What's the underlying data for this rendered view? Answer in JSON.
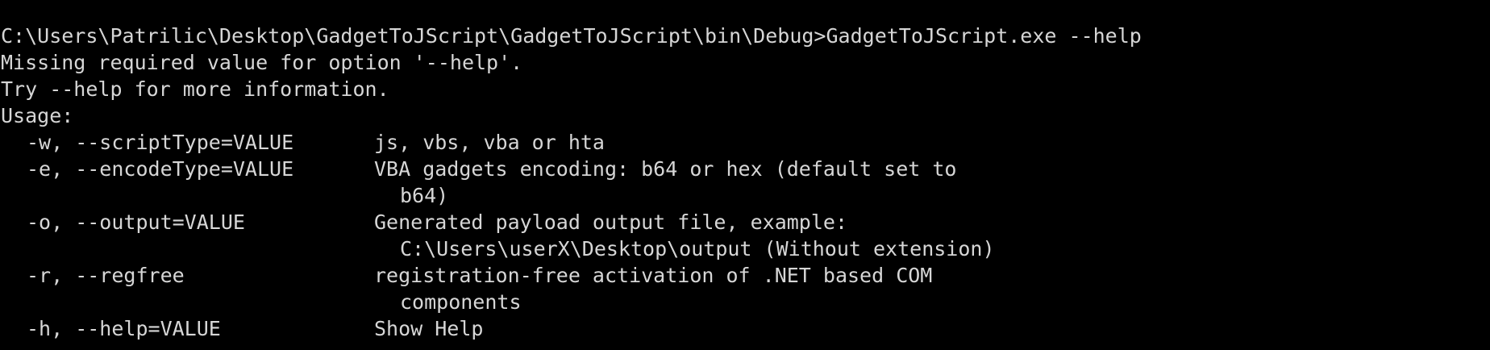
{
  "window": {
    "background": "#000000",
    "foreground": "#d6d6d6"
  },
  "console": {
    "command_line": "C:\\Users\\Patrilic\\Desktop\\GadgetToJScript\\GadgetToJScript\\bin\\Debug>GadgetToJScript.exe --help",
    "error_line": "Missing required value for option '--help'.",
    "hint_line": "Try --help for more information.",
    "usage_label": "Usage:",
    "options": [
      {
        "flag": "-w, --scriptType=VALUE",
        "description": "js, vbs, vba or hta",
        "continuation": ""
      },
      {
        "flag": "-e, --encodeType=VALUE",
        "description": "VBA gadgets encoding: b64 or hex (default set to",
        "continuation": "b64)"
      },
      {
        "flag": "-o, --output=VALUE",
        "description": "Generated payload output file, example:",
        "continuation": "C:\\Users\\userX\\Desktop\\output (Without extension)"
      },
      {
        "flag": "-r, --regfree",
        "description": "registration-free activation of .NET based COM",
        "continuation": "components"
      },
      {
        "flag": "-h, --help=VALUE",
        "description": "Show Help",
        "continuation": ""
      }
    ]
  }
}
